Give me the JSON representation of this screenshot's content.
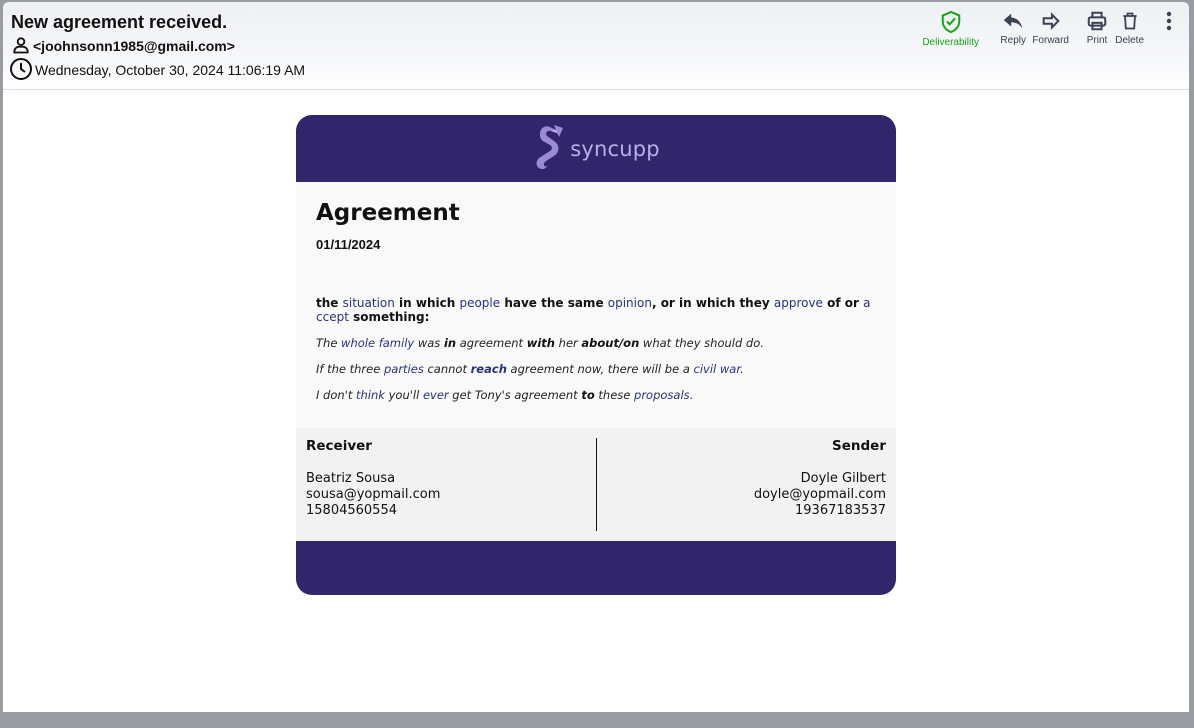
{
  "header": {
    "subject": "New agreement received.",
    "from": "<joohnsonn1985@gmail.com>",
    "date": "Wednesday, October 30, 2024 11:06:19 AM"
  },
  "toolbar": {
    "deliverability": "Deliverability",
    "reply": "Reply",
    "forward": "Forward",
    "print": "Print",
    "delete": "Delete"
  },
  "colors": {
    "brand": "#31256b",
    "logo": "#b9b0e8",
    "link": "#2a3379",
    "deliverability": "#17a317"
  },
  "email": {
    "brand_name": "syncupp",
    "title": "Agreement",
    "date": "01/11/2024",
    "definition": {
      "t1": "the ",
      "l1": "situation",
      "t2": " in which ",
      "l2": "people",
      "t3": " have the same ",
      "l3": "opinion",
      "t4": ", or in which they ",
      "l4": "approve",
      "t5": " of or ",
      "l5": "accept",
      "t6": " something:"
    },
    "examples": {
      "e1": {
        "a": "The ",
        "b": "whole family",
        "c": " was ",
        "d": "in",
        "e": " agreement ",
        "f": "with",
        "g": " her ",
        "h": "about/on",
        "i": " what they should do."
      },
      "e2": {
        "a": "If the three ",
        "b": "parties",
        "c": " cannot ",
        "d": "reach",
        "e": " agreement now, there will be a ",
        "f": "civil war",
        "g": "."
      },
      "e3": {
        "a": "I don't ",
        "b": "think",
        "c": " you'll ",
        "d": "ever",
        "e": " get Tony's agreement ",
        "f": "to",
        "g": " these ",
        "h": "proposals",
        "i": "."
      }
    },
    "receiver": {
      "label": "Receiver",
      "name": "Beatriz Sousa",
      "email": "sousa@yopmail.com",
      "phone": "15804560554"
    },
    "sender": {
      "label": "Sender",
      "name": "Doyle Gilbert",
      "email": "doyle@yopmail.com",
      "phone": "19367183537"
    }
  }
}
